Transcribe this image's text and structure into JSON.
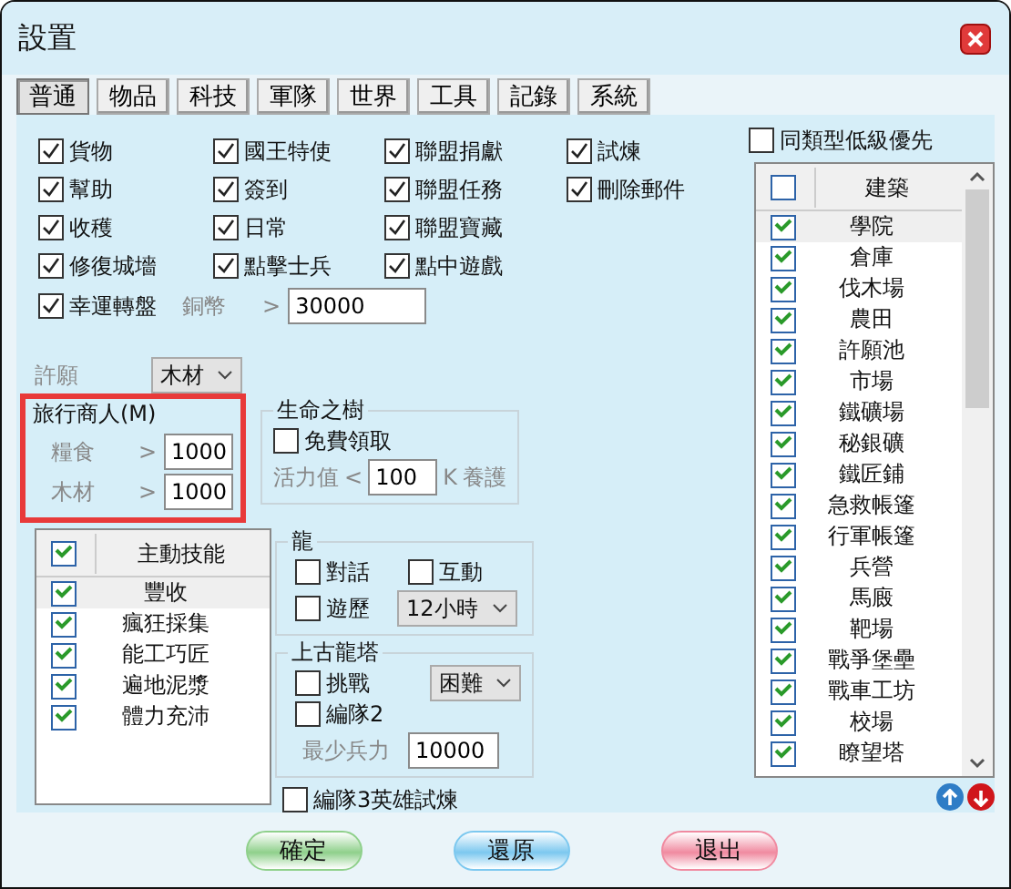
{
  "window": {
    "title": "設置"
  },
  "tabs": [
    {
      "label": "普通",
      "selected": true
    },
    {
      "label": "物品",
      "selected": false
    },
    {
      "label": "科技",
      "selected": false
    },
    {
      "label": "軍隊",
      "selected": false
    },
    {
      "label": "世界",
      "selected": false
    },
    {
      "label": "工具",
      "selected": false
    },
    {
      "label": "記錄",
      "selected": false
    },
    {
      "label": "系統",
      "selected": false
    }
  ],
  "option_rows": [
    [
      {
        "label": "貨物",
        "checked": true
      },
      {
        "label": "國王特使",
        "checked": true
      },
      {
        "label": "聯盟捐獻",
        "checked": true
      },
      {
        "label": "試煉",
        "checked": true
      }
    ],
    [
      {
        "label": "幫助",
        "checked": true
      },
      {
        "label": "簽到",
        "checked": true
      },
      {
        "label": "聯盟任務",
        "checked": true
      },
      {
        "label": "刪除郵件",
        "checked": true
      }
    ],
    [
      {
        "label": "收穫",
        "checked": true
      },
      {
        "label": "日常",
        "checked": true
      },
      {
        "label": "聯盟寶藏",
        "checked": true
      }
    ],
    [
      {
        "label": "修復城墻",
        "checked": true
      },
      {
        "label": "點擊士兵",
        "checked": true
      },
      {
        "label": "點中遊戲",
        "checked": true
      }
    ]
  ],
  "lucky_wheel": {
    "label": "幸運轉盤",
    "checked": true,
    "threshold_label": "銅幣",
    "comparator": ">",
    "value": "30000"
  },
  "wish": {
    "label": "許願",
    "value": "木材"
  },
  "traveling_merchant": {
    "title": "旅行商人(M)",
    "highlighted": true,
    "fields": [
      {
        "label": "糧食",
        "comparator": ">",
        "value": "1000"
      },
      {
        "label": "木材",
        "comparator": ">",
        "value": "1000"
      }
    ]
  },
  "tree_of_life": {
    "title": "生命之樹",
    "free_claim": {
      "label": "免費領取",
      "checked": false
    },
    "vitality": {
      "label": "活力值",
      "comparator": "<",
      "value": "100",
      "unit": "K",
      "action": "養護"
    }
  },
  "dragon": {
    "title": "龍",
    "talk": {
      "label": "對話",
      "checked": false
    },
    "interact": {
      "label": "互動",
      "checked": false
    },
    "travel": {
      "label": "遊歷",
      "checked": false
    },
    "duration": "12小時"
  },
  "ancient_tower": {
    "title": "上古龍塔",
    "challenge": {
      "label": "挑戰",
      "checked": false
    },
    "difficulty": "困難",
    "formation2": {
      "label": "編隊2",
      "checked": false
    },
    "min_troops": {
      "label": "最少兵力",
      "value": "10000"
    }
  },
  "formation3": {
    "label": "編隊3英雄試煉",
    "checked": false
  },
  "skills": {
    "header": {
      "label": "主動技能",
      "checked": true
    },
    "items": [
      {
        "label": "豐收",
        "checked": true,
        "selected": true
      },
      {
        "label": "瘋狂採集",
        "checked": true,
        "selected": false
      },
      {
        "label": "能工巧匠",
        "checked": true,
        "selected": false
      },
      {
        "label": "遍地泥漿",
        "checked": true,
        "selected": false
      },
      {
        "label": "體力充沛",
        "checked": true,
        "selected": false
      }
    ]
  },
  "low_level_first": {
    "label": "同類型低級優先",
    "checked": false
  },
  "buildings": {
    "header": {
      "label": "建築",
      "checked": false
    },
    "items": [
      {
        "label": "學院",
        "checked": true,
        "selected": true
      },
      {
        "label": "倉庫",
        "checked": true,
        "selected": false
      },
      {
        "label": "伐木場",
        "checked": true,
        "selected": false
      },
      {
        "label": "農田",
        "checked": true,
        "selected": false
      },
      {
        "label": "許願池",
        "checked": true,
        "selected": false
      },
      {
        "label": "市場",
        "checked": true,
        "selected": false
      },
      {
        "label": "鐵礦場",
        "checked": true,
        "selected": false
      },
      {
        "label": "秘銀礦",
        "checked": true,
        "selected": false
      },
      {
        "label": "鐵匠鋪",
        "checked": true,
        "selected": false
      },
      {
        "label": "急救帳篷",
        "checked": true,
        "selected": false
      },
      {
        "label": "行軍帳篷",
        "checked": true,
        "selected": false
      },
      {
        "label": "兵營",
        "checked": true,
        "selected": false
      },
      {
        "label": "馬廄",
        "checked": true,
        "selected": false
      },
      {
        "label": "靶場",
        "checked": true,
        "selected": false
      },
      {
        "label": "戰爭堡壘",
        "checked": true,
        "selected": false
      },
      {
        "label": "戰車工坊",
        "checked": true,
        "selected": false
      },
      {
        "label": "校場",
        "checked": true,
        "selected": false
      },
      {
        "label": "瞭望塔",
        "checked": true,
        "selected": false
      }
    ]
  },
  "buttons": [
    {
      "label": "確定",
      "kind": "confirm"
    },
    {
      "label": "還原",
      "kind": "reset"
    },
    {
      "label": "退出",
      "kind": "exit"
    }
  ]
}
